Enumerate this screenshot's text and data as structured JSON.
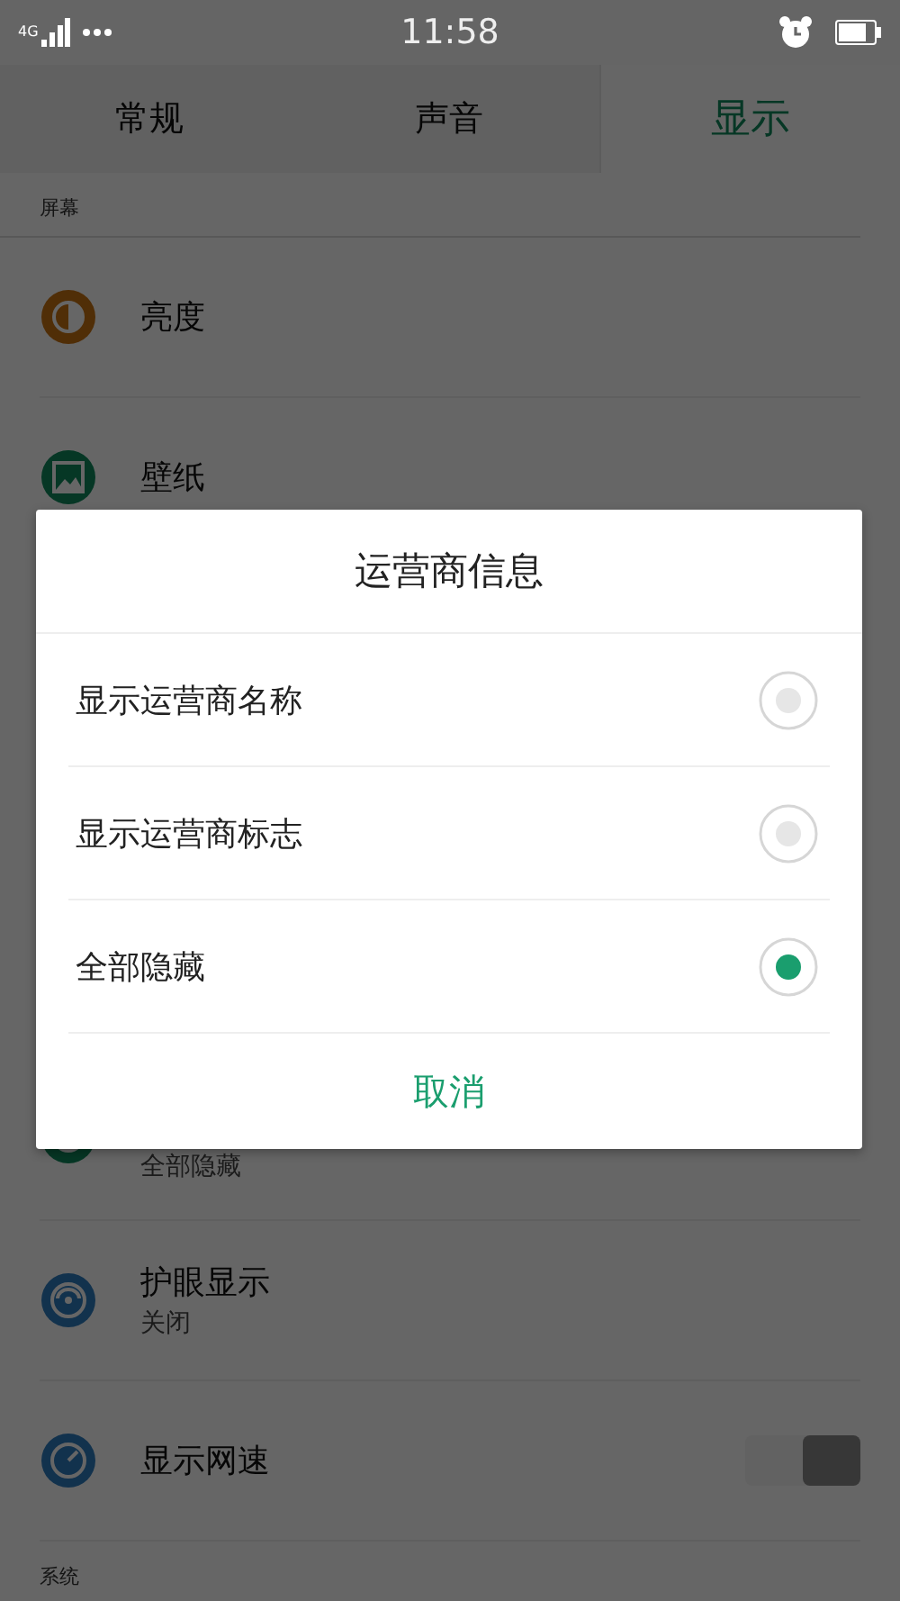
{
  "status_bar": {
    "network": "4G",
    "time": "11:58"
  },
  "tabs": [
    {
      "label": "常规",
      "selected": false
    },
    {
      "label": "声音",
      "selected": false
    },
    {
      "label": "显示",
      "selected": true
    }
  ],
  "sections": [
    {
      "header": "屏幕",
      "items": [
        {
          "kind": "plain",
          "title": "亮度"
        },
        {
          "kind": "plain",
          "title": "壁纸"
        },
        {
          "kind": "covered",
          "subtitle": "全部隐藏"
        },
        {
          "kind": "plain",
          "title": "护眼显示",
          "subtitle": "关闭"
        },
        {
          "kind": "toggle",
          "title": "显示网速",
          "on": true
        }
      ]
    },
    {
      "header": "系统"
    }
  ],
  "dialog": {
    "title": "运营商信息",
    "options": [
      {
        "label": "显示运营商名称",
        "selected": false
      },
      {
        "label": "显示运营商标志",
        "selected": false
      },
      {
        "label": "全部隐藏",
        "selected": true
      }
    ],
    "cancel": "取消"
  }
}
